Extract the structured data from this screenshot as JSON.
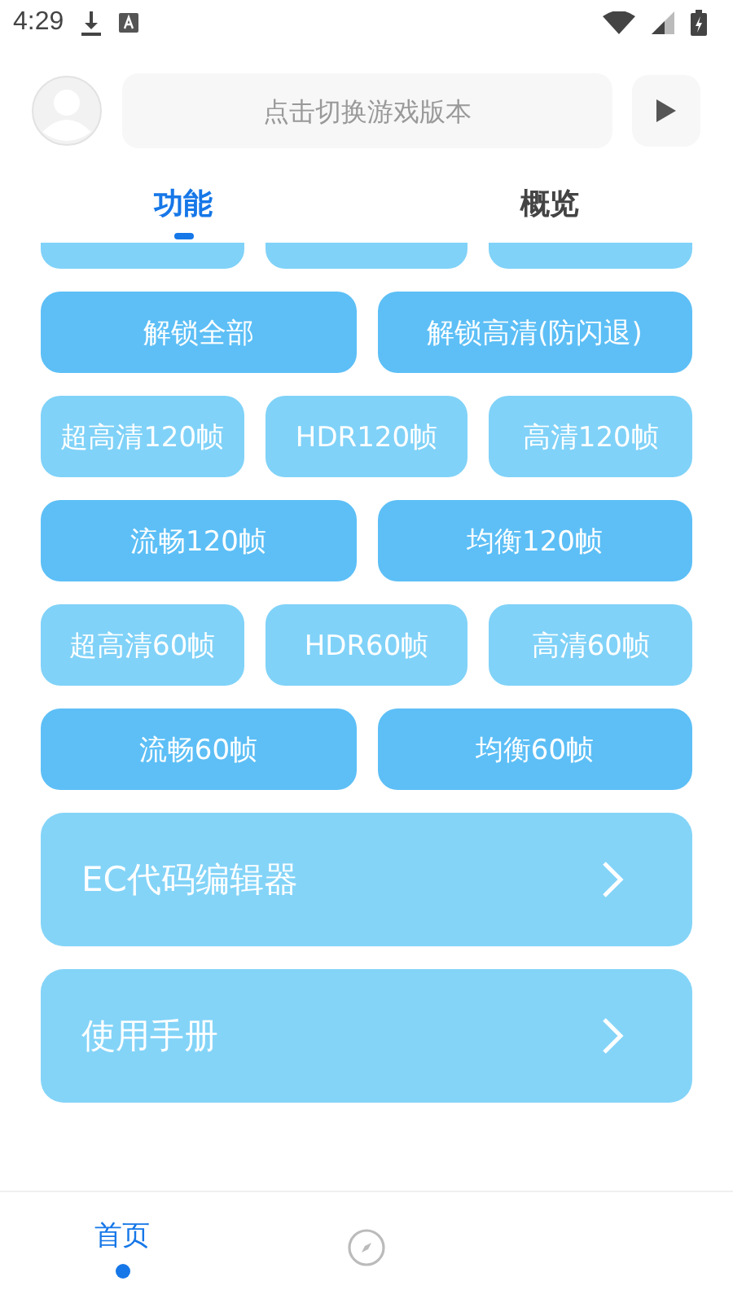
{
  "status_bar": {
    "time": "4:29"
  },
  "header": {
    "version_field": {
      "placeholder": "点击切换游戏版本"
    }
  },
  "tabs": [
    {
      "label": "功能",
      "selected": true
    },
    {
      "label": "概览",
      "selected": false
    }
  ],
  "button_rows": [
    {
      "kind": "pair",
      "buttons": [
        "解锁全部",
        "解锁高清(防闪退)"
      ]
    },
    {
      "kind": "triple",
      "buttons": [
        "超高清120帧",
        "HDR120帧",
        "高清120帧"
      ]
    },
    {
      "kind": "pair",
      "buttons": [
        "流畅120帧",
        "均衡120帧"
      ]
    },
    {
      "kind": "triple",
      "buttons": [
        "超高清60帧",
        "HDR60帧",
        "高清60帧"
      ]
    },
    {
      "kind": "pair",
      "buttons": [
        "流畅60帧",
        "均衡60帧"
      ]
    }
  ],
  "cards": [
    {
      "label": "EC代码编辑器"
    },
    {
      "label": "使用手册"
    }
  ],
  "bottom_nav": [
    {
      "kind": "text",
      "label": "首页",
      "selected": true
    },
    {
      "kind": "icon",
      "selected": false
    }
  ]
}
